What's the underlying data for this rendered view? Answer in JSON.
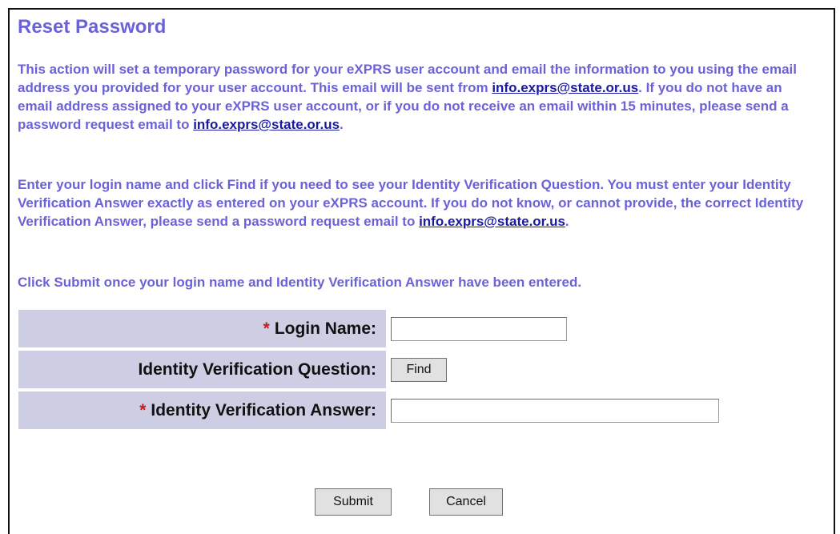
{
  "page": {
    "title": "Reset Password",
    "para1": {
      "t1": "This action will set a temporary password for your eXPRS user account and email the information to you using the email address you provided for your user account. This email will be sent from ",
      "link1": "info.exprs@state.or.us",
      "t2": ". If you do not have an email address assigned to your eXPRS user account, or if you do not receive an email within 15 minutes, please send a password request email to ",
      "link2": "info.exprs@state.or.us",
      "t3": "."
    },
    "para2": {
      "t1": "Enter your login name and click Find if you need to see your Identity Verification Question. You must enter your Identity Verification Answer exactly as entered on your eXPRS account. If you do not know, or cannot provide, the correct Identity Verification Answer, please send a password request email to ",
      "link": "info.exprs@state.or.us",
      "t2": "."
    },
    "para3": "Click Submit once your login name and Identity Verification Answer have been entered."
  },
  "form": {
    "required_marker": "*",
    "login_label": "Login Name:",
    "login_value": "",
    "question_label": "Identity Verification Question:",
    "find_button": "Find",
    "answer_label": "Identity Verification Answer:",
    "answer_value": ""
  },
  "actions": {
    "submit": "Submit",
    "cancel": "Cancel"
  },
  "colors": {
    "heading": "#6b62d8",
    "link": "#1a1aa0",
    "label_bg": "#cdcde4",
    "required": "#d01818"
  }
}
